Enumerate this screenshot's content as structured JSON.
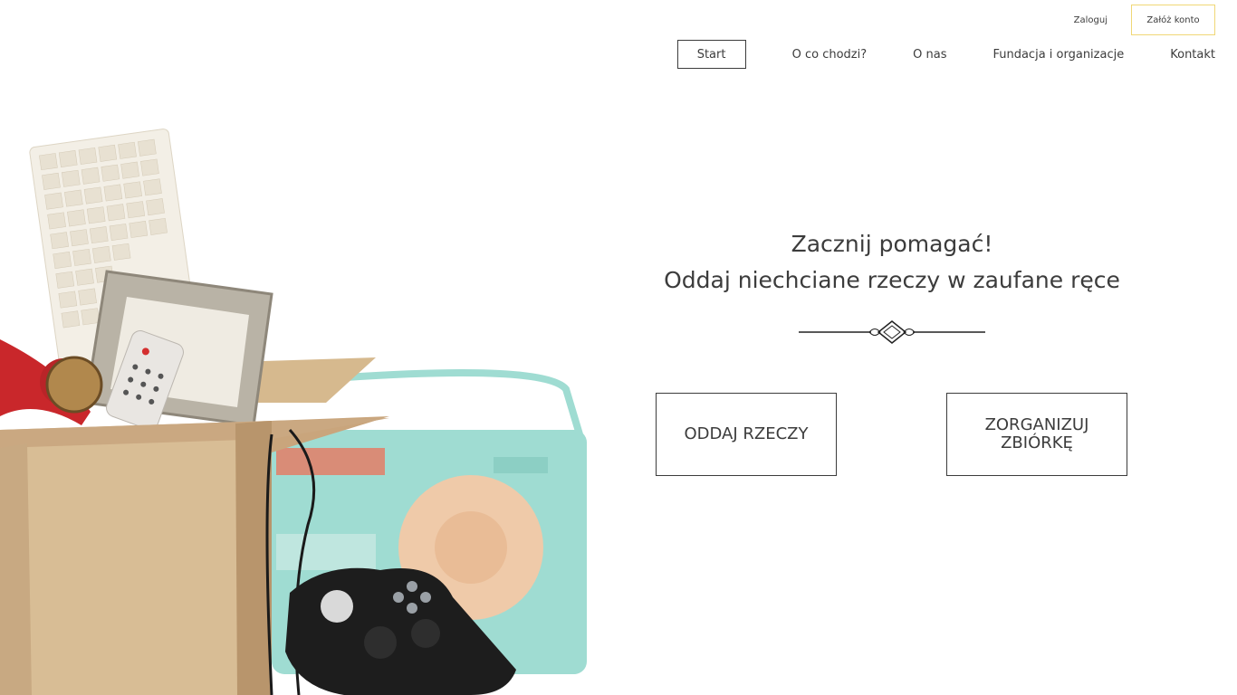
{
  "header": {
    "login_label": "Zaloguj",
    "register_label": "Załóż konto",
    "register_border_color": "#f0d776"
  },
  "nav": {
    "items": [
      {
        "label": "Start",
        "active": true
      },
      {
        "label": "O co chodzi?",
        "active": false
      },
      {
        "label": "O nas",
        "active": false
      },
      {
        "label": "Fundacja i organizacje",
        "active": false
      },
      {
        "label": "Kontakt",
        "active": false
      }
    ]
  },
  "hero": {
    "title_line1": "Zacznij pomagać!",
    "title_line2": "Oddaj niechciane rzeczy w zaufane ręce",
    "decoration_icon": "ornament-divider-icon",
    "buttons": {
      "give_label": "ODDAJ RZECZY",
      "organize_label": "ZORGANIZUJ ZBIÓRKĘ"
    }
  },
  "image": {
    "subject": "cardboard-box-with-old-items"
  },
  "colors": {
    "text": "#3c3c3c",
    "accent": "#f0d776"
  }
}
